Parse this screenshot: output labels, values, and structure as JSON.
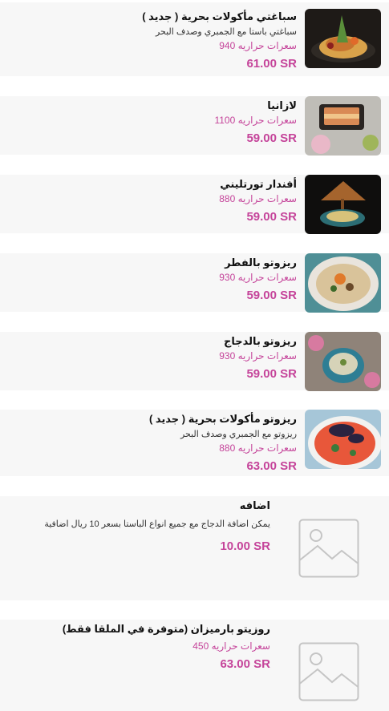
{
  "items": [
    {
      "name": "سباغتي مأكولات بحرية ( جديد )",
      "description": "سباغتي  باستا مع الجمبري وصدف البحر",
      "calories": "سعرات حراريه 940",
      "price": "61.00 SR",
      "image": "seafood-pasta-photo"
    },
    {
      "name": "لازانيا",
      "calories": "سعرات حراريه 1100",
      "price": "59.00 SR",
      "image": "lasagna-photo"
    },
    {
      "name": "أفندار تورتليني",
      "calories": "سعرات حراريه 880",
      "price": "59.00 SR",
      "image": "tortellini-photo"
    },
    {
      "name": "ريزوتو بالفطر",
      "calories": "سعرات حراريه 930",
      "price": "59.00 SR",
      "image": "mushroom-risotto-photo"
    },
    {
      "name": "ريزوتو بالدجاج",
      "calories": "سعرات حراريه 930",
      "price": "59.00 SR",
      "image": "chicken-risotto-photo"
    },
    {
      "name": "ريزوتو مأكولات بحرية ( جديد )",
      "description": "ريزوتو مع الجمبري وصدف البحر",
      "calories": "سعرات حراريه 880",
      "price": "63.00 SR",
      "image": "seafood-risotto-photo"
    },
    {
      "name": "اضافه",
      "description": "يمكن اضافة الدجاج مع جميع انواع الباستا بسعر 10 ريال اضافية",
      "price": "10.00 SR",
      "image": "image-placeholder-icon"
    },
    {
      "name": "روزيتو بارميزان (متوفرة في الملقا فقط)",
      "calories": "سعرات حراريه 450",
      "price": "63.00 SR",
      "image": "image-placeholder-icon"
    }
  ],
  "colors": {
    "accent": "#c5449a",
    "card": "#f7f7f7",
    "text": "#111111"
  }
}
